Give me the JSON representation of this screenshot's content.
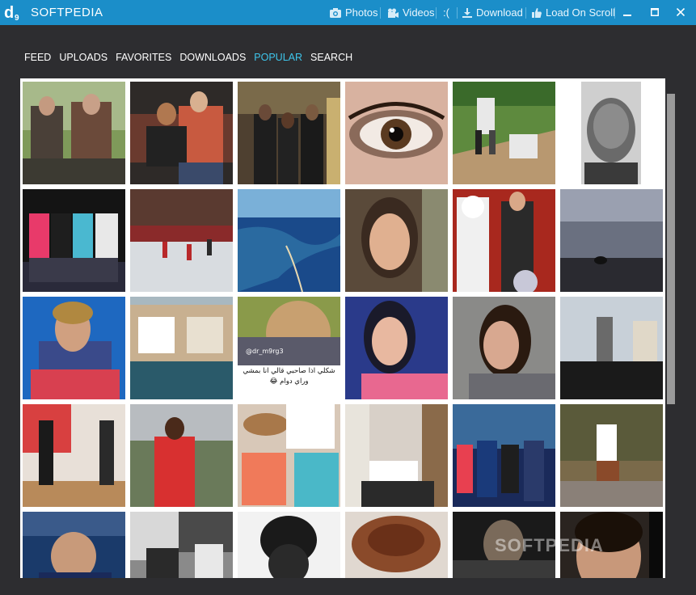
{
  "app": {
    "title": "SOFTPEDIA",
    "logo_icon": "softpedia-d9-logo"
  },
  "toolbar": {
    "photos_label": "Photos",
    "videos_label": "Videos",
    "sad_label": ":(",
    "download_label": "Download",
    "load_on_scroll_label": "Load On Scroll"
  },
  "window_controls": [
    "minimize",
    "maximize",
    "close"
  ],
  "nav": {
    "items": [
      {
        "label": "FEED",
        "active": false
      },
      {
        "label": "UPLOADS",
        "active": false
      },
      {
        "label": "FAVORITES",
        "active": false
      },
      {
        "label": "DOWNLOADS",
        "active": false
      },
      {
        "label": "POPULAR",
        "active": true
      },
      {
        "label": "SEARCH",
        "active": false
      }
    ]
  },
  "gallery": {
    "tile_2_2": {
      "handle": "@dr_m9rg3",
      "caption": "شكلي اذا صاحبي قالي انا بمشي وراي دوام 😂"
    },
    "watermark": "SOFTPEDIA"
  },
  "colors": {
    "titlebar": "#1b8ec9",
    "background": "#2d2d30",
    "nav_active": "#3ec6ec",
    "gallery_bg": "#ffffff"
  }
}
